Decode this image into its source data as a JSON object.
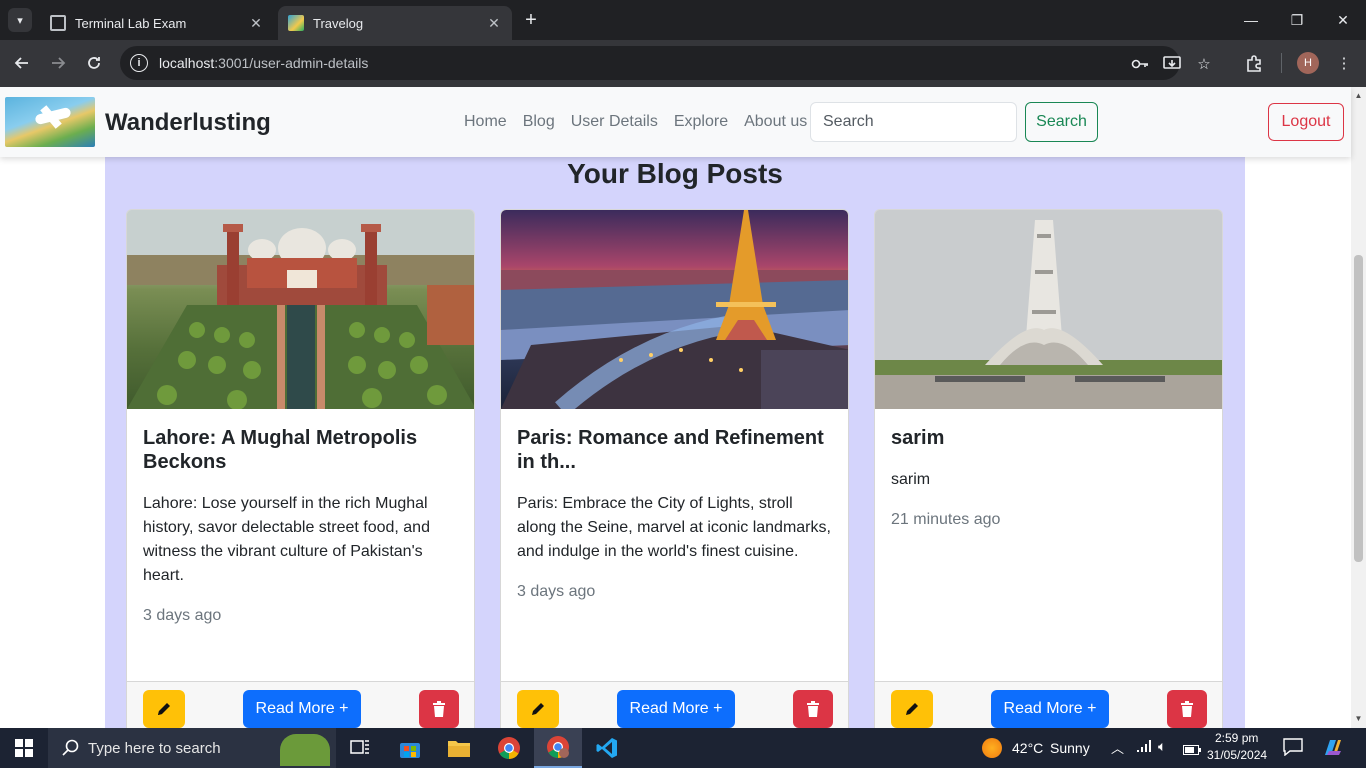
{
  "browser": {
    "tabs": [
      {
        "title": "Terminal Lab Exam",
        "active": false
      },
      {
        "title": "Travelog",
        "active": true
      }
    ],
    "url_host": "localhost",
    "url_path": ":3001/user-admin-details",
    "profile_initial": "H"
  },
  "site": {
    "brand": "Wanderlusting",
    "nav_links": [
      "Home",
      "Blog",
      "User Details",
      "Explore",
      "About us"
    ],
    "search_placeholder": "Search",
    "search_button": "Search",
    "logout_button": "Logout"
  },
  "page": {
    "heading": "Your Blog Posts",
    "posts": [
      {
        "title": "Lahore: A Mughal Metropolis Beckons",
        "excerpt": "Lahore: Lose yourself in the rich Mughal history, savor delectable street food, and witness the vibrant culture of Pakistan's heart.",
        "time": "3 days ago",
        "read_more": "Read More +"
      },
      {
        "title": "Paris: Romance and Refinement in th...",
        "excerpt": "Paris: Embrace the City of Lights, stroll along the Seine, marvel at iconic landmarks, and indulge in the world's finest cuisine.",
        "time": "3 days ago",
        "read_more": "Read More +"
      },
      {
        "title": "sarim",
        "excerpt": "sarim",
        "time": "21 minutes ago",
        "read_more": "Read More +"
      }
    ]
  },
  "taskbar": {
    "search_placeholder": "Type here to search",
    "weather_temp": "42°C",
    "weather_desc": "Sunny",
    "time": "2:59 pm",
    "date": "31/05/2024"
  },
  "colors": {
    "content_bg": "#d4d4fc",
    "edit": "#ffc107",
    "read_more": "#0d6efd",
    "delete": "#dc3545",
    "search_btn": "#198754"
  }
}
